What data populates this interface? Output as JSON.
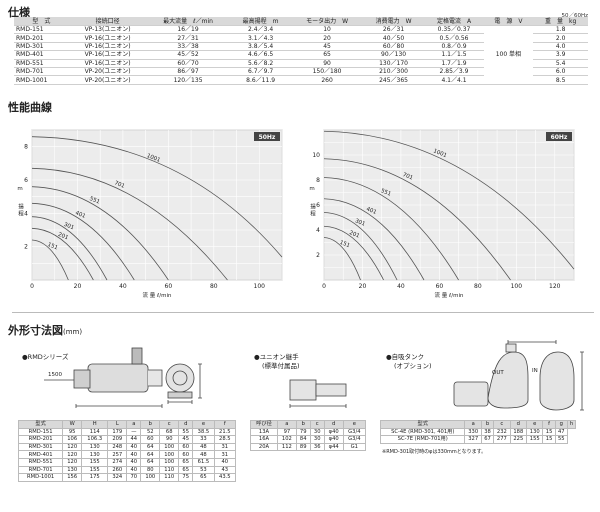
{
  "spec": {
    "title": "仕様",
    "freq": "50／60Hz",
    "headers": [
      "型　式",
      "接続口径",
      "最大流量　ℓ／min",
      "最高揚程　m",
      "モータ出力　W",
      "消費電力　W",
      "定格電流　A",
      "電　源　V",
      "重　量　kg"
    ],
    "rows": [
      [
        "RMD-151",
        "VP-13(ユニオン)",
        "16／19",
        "2.4／3.4",
        "10",
        "26／31",
        "0.35／0.37",
        "1.8"
      ],
      [
        "RMD-201",
        "VP-16(ユニオン)",
        "27／31",
        "3.1／4.3",
        "20",
        "40／50",
        "0.5／0.56",
        "2.0"
      ],
      [
        "RMD-301",
        "VP-16(ユニオン)",
        "33／38",
        "3.8／5.4",
        "45",
        "60／80",
        "0.8／0.9",
        "4.0"
      ],
      [
        "RMD-401",
        "VP-16(ユニオン)",
        "45／52",
        "4.6／6.5",
        "65",
        "90／130",
        "1.1／1.5",
        "3.9"
      ],
      [
        "RMD-551",
        "VP-16(ユニオン)",
        "60／70",
        "5.6／8.2",
        "90",
        "130／170",
        "1.7／1.9",
        "5.4"
      ],
      [
        "RMD-701",
        "VP-20(ユニオン)",
        "86／97",
        "6.7／9.7",
        "150／180",
        "210／300",
        "2.85／3.9",
        "6.0"
      ],
      [
        "RMD-1001",
        "VP-20(ユニオン)",
        "120／135",
        "8.6／11.9",
        "260",
        "245／365",
        "4.1／4.1",
        "8.5"
      ]
    ],
    "power": "100 単相"
  },
  "curves": {
    "title": "性能曲線",
    "ylabel": "揚 程",
    "yunit": "m",
    "xlabel": "流 量 ℓ/min"
  },
  "chart_data": [
    {
      "type": "line",
      "title": "50Hz",
      "xlabel": "流 量 ℓ/min",
      "ylabel": "揚 程 m",
      "xlim": [
        0,
        110
      ],
      "ylim": [
        0,
        9
      ],
      "xticks": [
        0,
        20,
        40,
        60,
        80,
        100
      ],
      "yticks": [
        2,
        4,
        6,
        8
      ],
      "grid": true,
      "series": [
        {
          "name": "151",
          "x": [
            0,
            16
          ],
          "y": [
            2.4,
            0
          ]
        },
        {
          "name": "201",
          "x": [
            0,
            27
          ],
          "y": [
            3.1,
            0
          ]
        },
        {
          "name": "301",
          "x": [
            0,
            33
          ],
          "y": [
            3.8,
            0
          ]
        },
        {
          "name": "401",
          "x": [
            0,
            45
          ],
          "y": [
            4.6,
            0
          ]
        },
        {
          "name": "551",
          "x": [
            0,
            60
          ],
          "y": [
            5.6,
            0
          ]
        },
        {
          "name": "701",
          "x": [
            0,
            86
          ],
          "y": [
            6.7,
            0
          ]
        },
        {
          "name": "1001",
          "x": [
            0,
            120
          ],
          "y": [
            8.6,
            0
          ]
        }
      ]
    },
    {
      "type": "line",
      "title": "60Hz",
      "xlabel": "流 量 ℓ/min",
      "ylabel": "揚 程 m",
      "xlim": [
        0,
        130
      ],
      "ylim": [
        0,
        12
      ],
      "xticks": [
        0,
        20,
        40,
        60,
        80,
        100,
        120
      ],
      "yticks": [
        2,
        4,
        6,
        8,
        10
      ],
      "grid": true,
      "series": [
        {
          "name": "151",
          "x": [
            0,
            19
          ],
          "y": [
            3.4,
            0
          ]
        },
        {
          "name": "201",
          "x": [
            0,
            31
          ],
          "y": [
            4.3,
            0
          ]
        },
        {
          "name": "301",
          "x": [
            0,
            38
          ],
          "y": [
            5.4,
            0
          ]
        },
        {
          "name": "401",
          "x": [
            0,
            52
          ],
          "y": [
            6.5,
            0
          ]
        },
        {
          "name": "551",
          "x": [
            0,
            70
          ],
          "y": [
            8.2,
            0
          ]
        },
        {
          "name": "701",
          "x": [
            0,
            97
          ],
          "y": [
            9.7,
            0
          ]
        },
        {
          "name": "1001",
          "x": [
            0,
            135
          ],
          "y": [
            11.9,
            0
          ]
        }
      ]
    }
  ],
  "dims": {
    "title": "外形寸法図",
    "unit": "(mm)",
    "rmd_label": "●RMDシリーズ",
    "cable": "1500",
    "union_label": "●ユニオン継手",
    "union_sub": "(標準付属品)",
    "tank_label": "●自吸タンク",
    "tank_sub": "(オプション)",
    "rmd_table": {
      "headers": [
        "型式",
        "W",
        "H",
        "L",
        "a",
        "b",
        "c",
        "d",
        "e",
        "f"
      ],
      "rows": [
        [
          "RMD-151",
          "95",
          "114",
          "179",
          "—",
          "52",
          "68",
          "55",
          "38.5",
          "21.5"
        ],
        [
          "RMD-201",
          "106",
          "106.3",
          "209",
          "44",
          "60",
          "90",
          "45",
          "33",
          "28.5"
        ],
        [
          "RMD-301",
          "120",
          "130",
          "248",
          "40",
          "64",
          "100",
          "60",
          "48",
          "31"
        ],
        [
          "RMD-401",
          "120",
          "130",
          "257",
          "40",
          "64",
          "100",
          "60",
          "48",
          "31"
        ],
        [
          "RMD-551",
          "120",
          "155",
          "274",
          "40",
          "64",
          "100",
          "65",
          "61.5",
          "40"
        ],
        [
          "RMD-701",
          "130",
          "155",
          "260",
          "40",
          "80",
          "110",
          "65",
          "53",
          "43"
        ],
        [
          "RMD-1001",
          "156",
          "175",
          "324",
          "70",
          "100",
          "110",
          "75",
          "65",
          "43.5"
        ]
      ]
    },
    "union_table": {
      "headers": [
        "呼び径",
        "a",
        "b",
        "c",
        "d",
        "e"
      ],
      "rows": [
        [
          "13A",
          "97",
          "79",
          "30",
          "φ40",
          "G3/4"
        ],
        [
          "16A",
          "102",
          "84",
          "30",
          "φ40",
          "G3/4"
        ],
        [
          "20A",
          "112",
          "89",
          "36",
          "φ44",
          "G1"
        ]
      ]
    },
    "tank_table": {
      "headers": [
        "型式",
        "a",
        "b",
        "c",
        "d",
        "e",
        "f",
        "g",
        "h"
      ],
      "rows": [
        [
          "SC-4E (RMD-301, 401用)",
          "330",
          "38",
          "232",
          "188",
          "130",
          "15",
          "47"
        ],
        [
          "SC-7E (RMD-701用)",
          "327",
          "67",
          "277",
          "225",
          "155",
          "15",
          "55"
        ]
      ]
    },
    "tank_note": "※RMD-301取付時のφは330mmとなります。",
    "labels": {
      "out": "OUT",
      "in": "IN"
    }
  }
}
